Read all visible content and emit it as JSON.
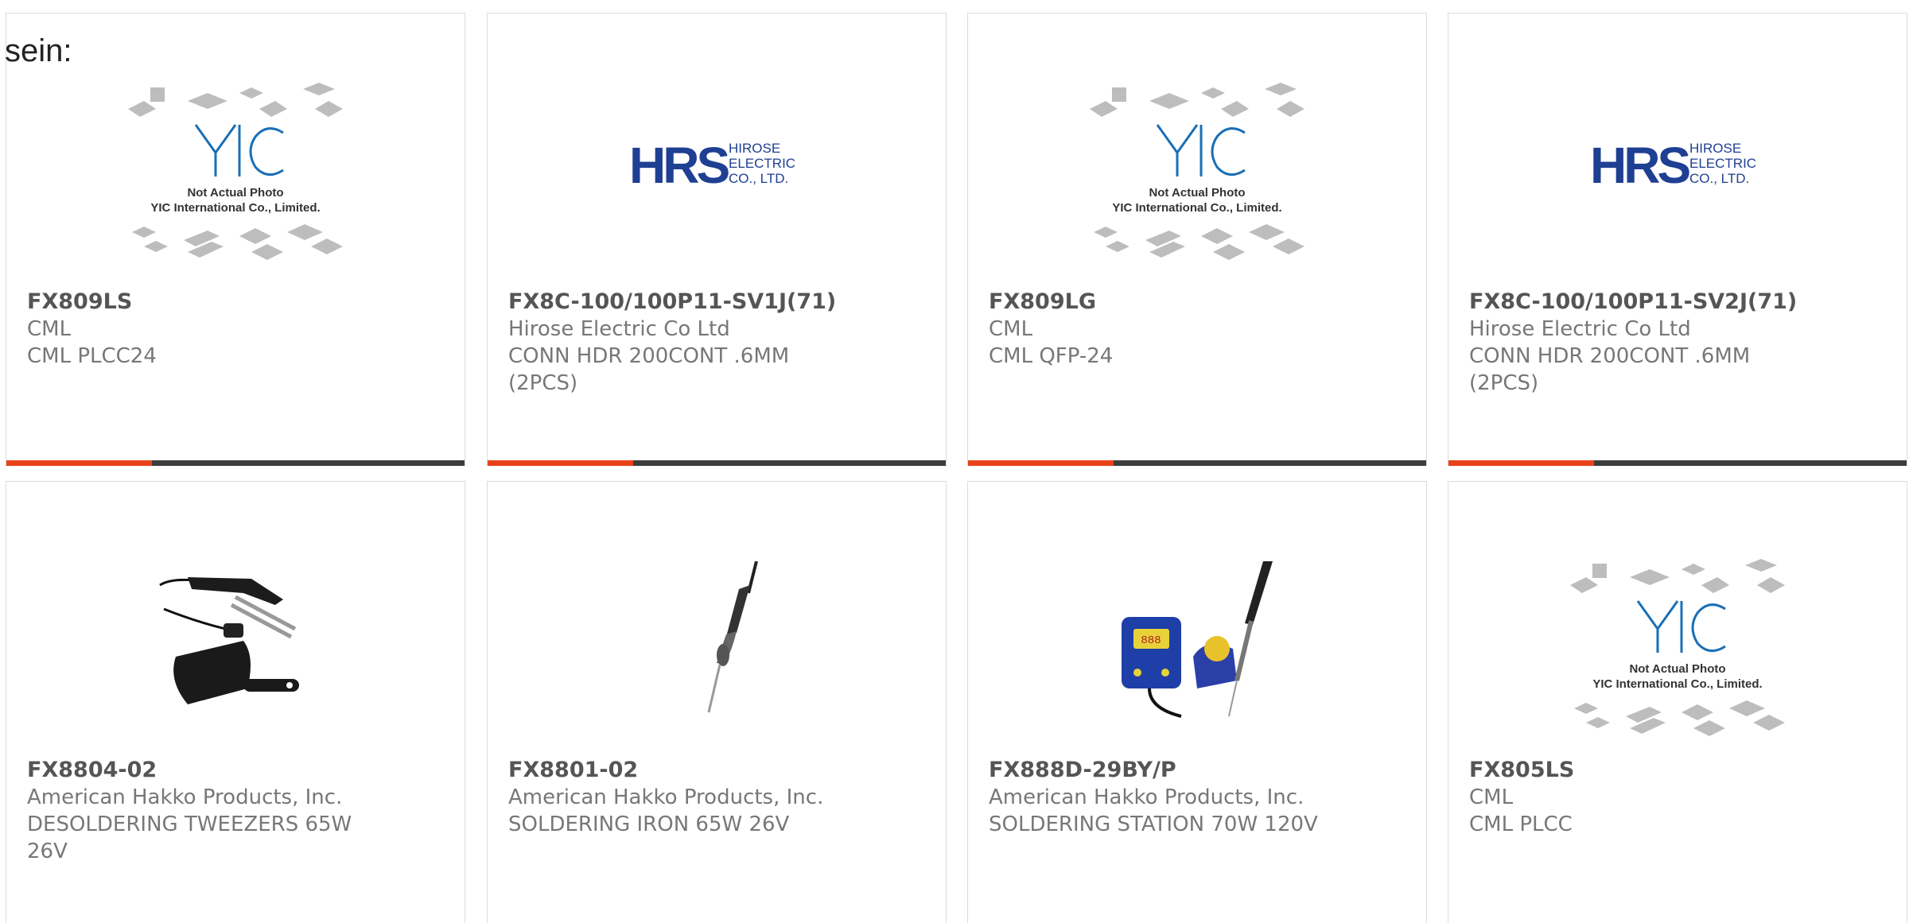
{
  "intro_text": "sein:",
  "placeholder_caption": [
    "Not Actual Photo",
    "YIC International Co., Limited."
  ],
  "hirose_logo": {
    "mark": "HRS",
    "lines": [
      "HIROSE",
      "ELECTRIC",
      "CO., LTD."
    ]
  },
  "colors": {
    "accent": "#e8421a",
    "bar": "#3c3c3c",
    "yic": "#1a6fb5",
    "hrs": "#1f3f93"
  },
  "products": [
    {
      "part": "FX809LS",
      "manufacturer": "CML",
      "description": "CML PLCC24",
      "image": "yic-placeholder"
    },
    {
      "part": "FX8C-100/100P11-SV1J(71)",
      "manufacturer": "Hirose Electric Co Ltd",
      "description": "CONN HDR 200CONT .6MM (2PCS)",
      "image": "hirose-logo"
    },
    {
      "part": "FX809LG",
      "manufacturer": "CML",
      "description": "CML QFP-24",
      "image": "yic-placeholder"
    },
    {
      "part": "FX8C-100/100P11-SV2J(71)",
      "manufacturer": "Hirose Electric Co Ltd",
      "description": "CONN HDR 200CONT .6MM (2PCS)",
      "image": "hirose-logo"
    },
    {
      "part": "FX8804-02",
      "manufacturer": "American Hakko Products, Inc.",
      "description": "DESOLDERING TWEEZERS 65W 26V",
      "image": "tweezers-photo"
    },
    {
      "part": "FX8801-02",
      "manufacturer": "American Hakko Products, Inc.",
      "description": "SOLDERING IRON 65W 26V",
      "image": "iron-photo"
    },
    {
      "part": "FX888D-29BY/P",
      "manufacturer": "American Hakko Products, Inc.",
      "description": "SOLDERING STATION 70W 120V",
      "image": "station-photo"
    },
    {
      "part": "FX805LS",
      "manufacturer": "CML",
      "description": "CML PLCC",
      "image": "yic-placeholder"
    }
  ]
}
